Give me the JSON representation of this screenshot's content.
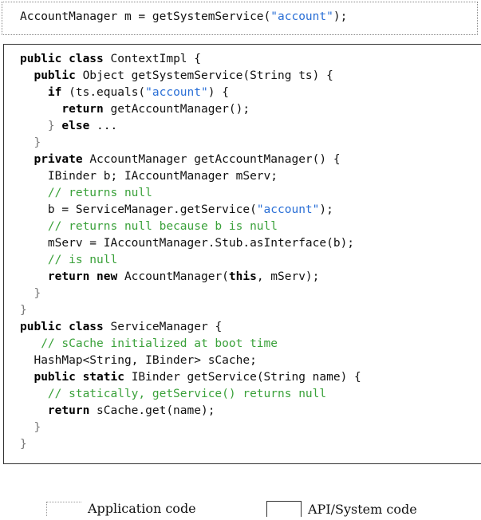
{
  "application_code": {
    "line": [
      {
        "t": "AccountManager m = getSystemService(",
        "c": "plain"
      },
      {
        "t": "\"account\"",
        "c": "str"
      },
      {
        "t": ");",
        "c": "plain"
      }
    ]
  },
  "system_code": {
    "lines": [
      [
        {
          "t": "public class ",
          "c": "kw"
        },
        {
          "t": "ContextImpl {",
          "c": "plain"
        }
      ],
      [
        {
          "t": "  ",
          "c": "plain"
        },
        {
          "t": "public ",
          "c": "kw"
        },
        {
          "t": "Object getSystemService(String ts) {",
          "c": "plain"
        }
      ],
      [
        {
          "t": "    ",
          "c": "plain"
        },
        {
          "t": "if ",
          "c": "kw"
        },
        {
          "t": "(ts.equals(",
          "c": "plain"
        },
        {
          "t": "\"account\"",
          "c": "str"
        },
        {
          "t": ") {",
          "c": "plain"
        }
      ],
      [
        {
          "t": "      ",
          "c": "plain"
        },
        {
          "t": "return ",
          "c": "kw"
        },
        {
          "t": "getAccountManager();",
          "c": "plain"
        }
      ],
      [
        {
          "t": "    } ",
          "c": "brace"
        },
        {
          "t": "else ",
          "c": "kw"
        },
        {
          "t": "...",
          "c": "plain"
        }
      ],
      [
        {
          "t": "  }",
          "c": "brace"
        }
      ],
      [
        {
          "t": "  ",
          "c": "plain"
        },
        {
          "t": "private ",
          "c": "kw"
        },
        {
          "t": "AccountManager getAccountManager() {",
          "c": "plain"
        }
      ],
      [
        {
          "t": "    IBinder b; IAccountManager mServ;",
          "c": "plain"
        }
      ],
      [
        {
          "t": "    // returns null",
          "c": "cmt"
        }
      ],
      [
        {
          "t": "    b = ServiceManager.getService(",
          "c": "plain"
        },
        {
          "t": "\"account\"",
          "c": "str"
        },
        {
          "t": ");",
          "c": "plain"
        }
      ],
      [
        {
          "t": "    // returns null because b is null",
          "c": "cmt"
        }
      ],
      [
        {
          "t": "    mServ = IAccountManager.Stub.asInterface(b);",
          "c": "plain"
        }
      ],
      [
        {
          "t": "    // is null",
          "c": "cmt"
        }
      ],
      [
        {
          "t": "    ",
          "c": "plain"
        },
        {
          "t": "return new ",
          "c": "kw"
        },
        {
          "t": "AccountManager(",
          "c": "plain"
        },
        {
          "t": "this",
          "c": "kw"
        },
        {
          "t": ", mServ);",
          "c": "plain"
        }
      ],
      [
        {
          "t": "  }",
          "c": "brace"
        }
      ],
      [
        {
          "t": "}",
          "c": "brace"
        }
      ],
      [
        {
          "t": "public class ",
          "c": "kw"
        },
        {
          "t": "ServiceManager {",
          "c": "plain"
        }
      ],
      [
        {
          "t": "   // sCache initialized at boot time",
          "c": "cmt"
        }
      ],
      [
        {
          "t": "  HashMap<String, IBinder> sCache;",
          "c": "plain"
        }
      ],
      [
        {
          "t": "  ",
          "c": "plain"
        },
        {
          "t": "public static ",
          "c": "kw"
        },
        {
          "t": "IBinder getService(String name) {",
          "c": "plain"
        }
      ],
      [
        {
          "t": "    // statically, getService() returns null",
          "c": "cmt"
        }
      ],
      [
        {
          "t": "    ",
          "c": "plain"
        },
        {
          "t": "return ",
          "c": "kw"
        },
        {
          "t": "sCache.get(name);",
          "c": "plain"
        }
      ],
      [
        {
          "t": "  }",
          "c": "brace"
        }
      ],
      [
        {
          "t": "}",
          "c": "brace"
        }
      ]
    ]
  },
  "legend": {
    "app_label": "Application code",
    "sys_label": "API/System code"
  }
}
